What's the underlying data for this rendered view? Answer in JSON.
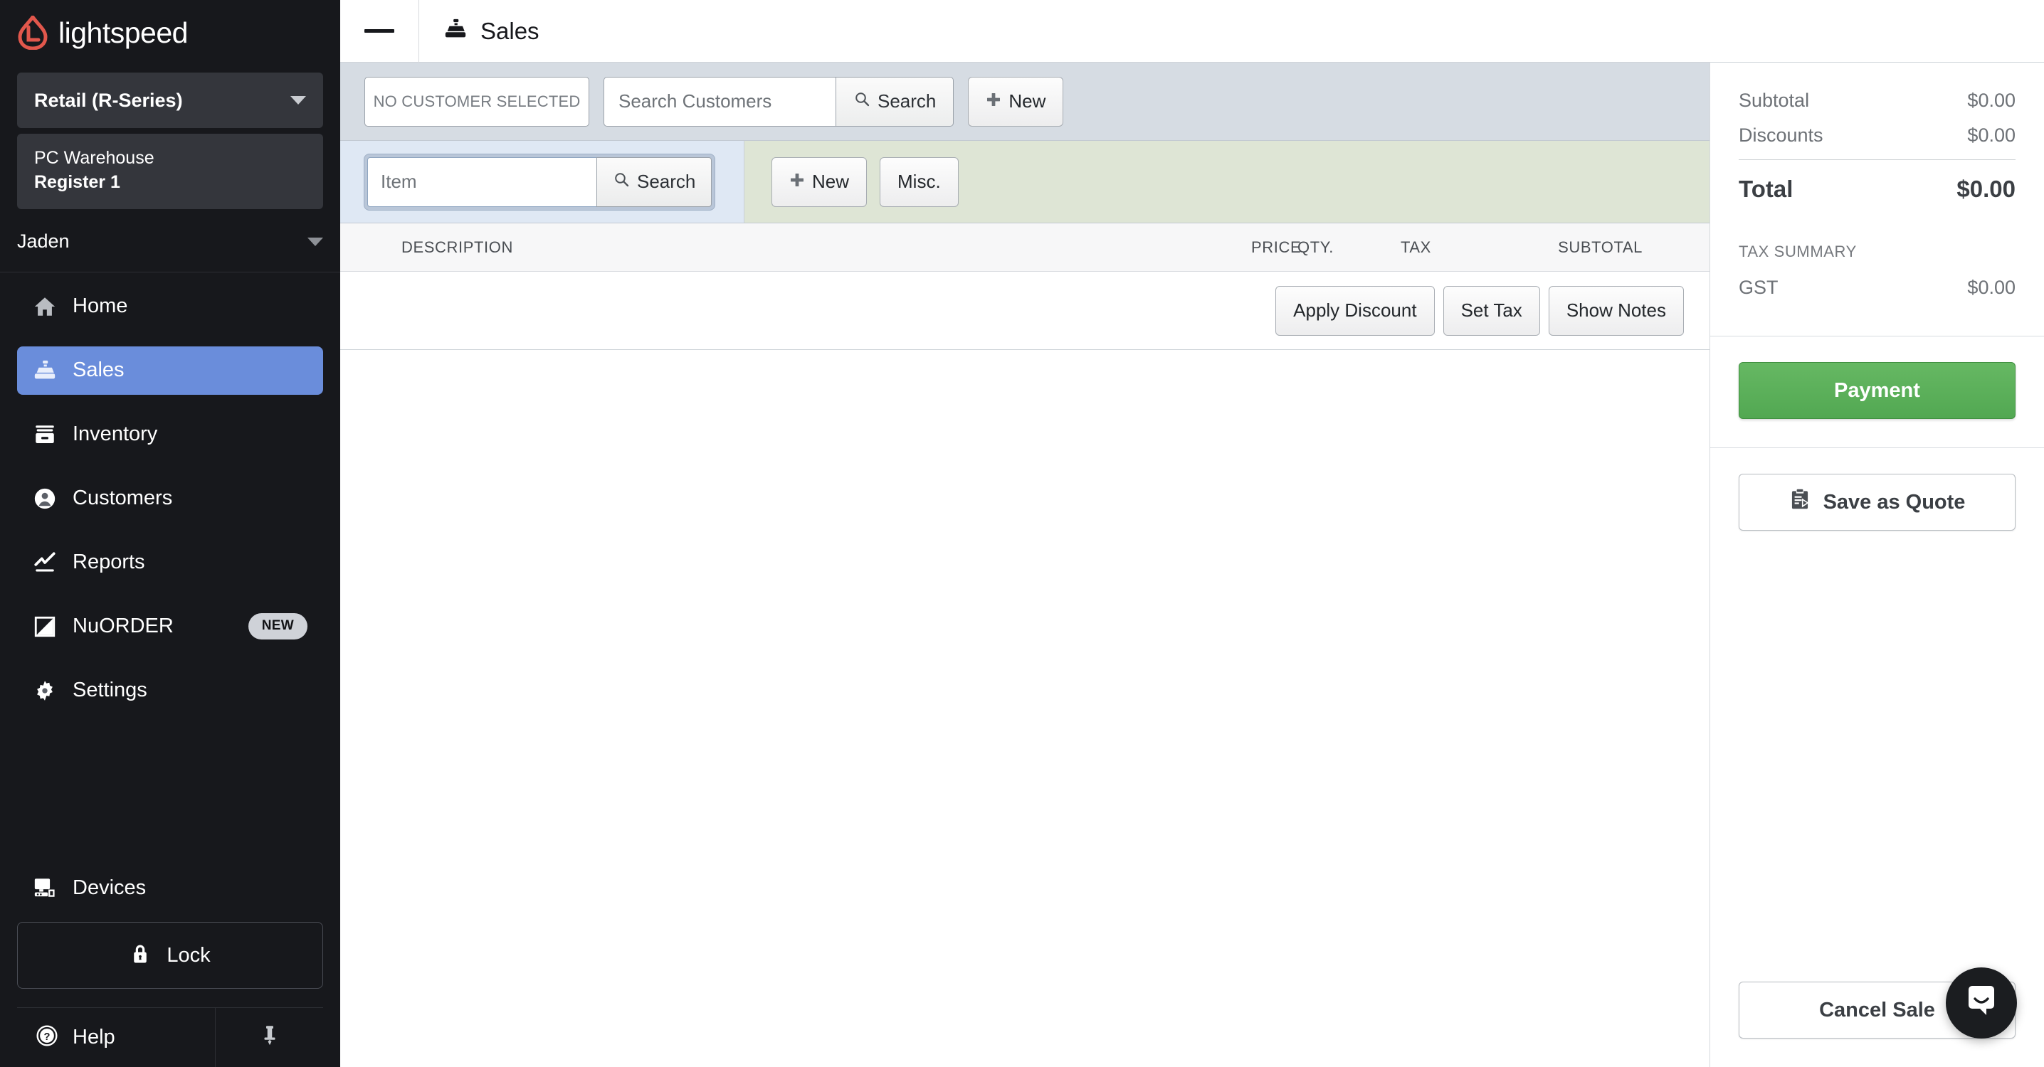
{
  "sidebar": {
    "brand": {
      "name": "lightspeed",
      "logo_icon": "lightspeed-flame-logo"
    },
    "account_selector": {
      "label": "Retail (R-Series)",
      "icon": "chevron-down-icon"
    },
    "store": {
      "name": "PC Warehouse",
      "register": "Register 1"
    },
    "user": {
      "name": "Jaden",
      "icon": "chevron-down-icon"
    },
    "items": [
      {
        "label": "Home",
        "icon": "home-icon",
        "active": false
      },
      {
        "label": "Sales",
        "icon": "register-icon",
        "active": true
      },
      {
        "label": "Inventory",
        "icon": "inventory-icon",
        "active": false
      },
      {
        "label": "Customers",
        "icon": "person-icon",
        "active": false
      },
      {
        "label": "Reports",
        "icon": "chart-line-icon",
        "active": false
      },
      {
        "label": "NuORDER",
        "icon": "nuorder-icon",
        "active": false,
        "badge": "NEW"
      },
      {
        "label": "Settings",
        "icon": "gear-icon",
        "active": false
      }
    ],
    "devices": {
      "label": "Devices",
      "icon": "monitor-icon"
    },
    "lock": {
      "label": "Lock",
      "icon": "lock-icon"
    },
    "help": {
      "label": "Help",
      "icon": "question-circle-icon"
    },
    "pin": {
      "icon": "pin-icon"
    }
  },
  "topbar": {
    "menu_icon": "hamburger-menu-icon",
    "title": "Sales",
    "title_icon": "register-icon"
  },
  "customer_bar": {
    "status": "NO CUSTOMER SELECTED",
    "search_placeholder": "Search Customers",
    "search_value": "",
    "search_button": "Search",
    "search_icon": "search-icon",
    "new_button": "New",
    "new_icon": "plus-icon"
  },
  "item_bar": {
    "item_placeholder": "Item",
    "item_value": "",
    "search_button": "Search",
    "search_icon": "search-icon",
    "new_button": "New",
    "new_icon": "plus-icon",
    "misc_button": "Misc."
  },
  "line_table": {
    "columns": [
      "DESCRIPTION",
      "PRICE",
      "QTY.",
      "TAX",
      "SUBTOTAL"
    ],
    "rows": []
  },
  "sale_actions": {
    "apply_discount": "Apply Discount",
    "set_tax": "Set Tax",
    "show_notes": "Show Notes"
  },
  "right_panel": {
    "subtotal_label": "Subtotal",
    "subtotal_value": "$0.00",
    "discounts_label": "Discounts",
    "discounts_value": "$0.00",
    "total_label": "Total",
    "total_value": "$0.00",
    "tax_summary_label": "TAX SUMMARY",
    "tax_rows": [
      {
        "label": "GST",
        "value": "$0.00"
      }
    ],
    "payment_button": "Payment",
    "save_quote_button": "Save as Quote",
    "save_quote_icon": "clipboard-icon",
    "cancel_sale_button": "Cancel Sale"
  },
  "chat": {
    "icon": "chat-smile-icon"
  },
  "colors": {
    "sidebar_bg": "#17181c",
    "active_nav": "#6a8ddb",
    "brand_red": "#e2574c",
    "customer_bar": "#d6dce3",
    "item_bar_blue": "#dfe8f4",
    "item_bar_green": "#dee5d5",
    "payment_green": "#52a852",
    "chat_bg": "#1b1d20"
  }
}
